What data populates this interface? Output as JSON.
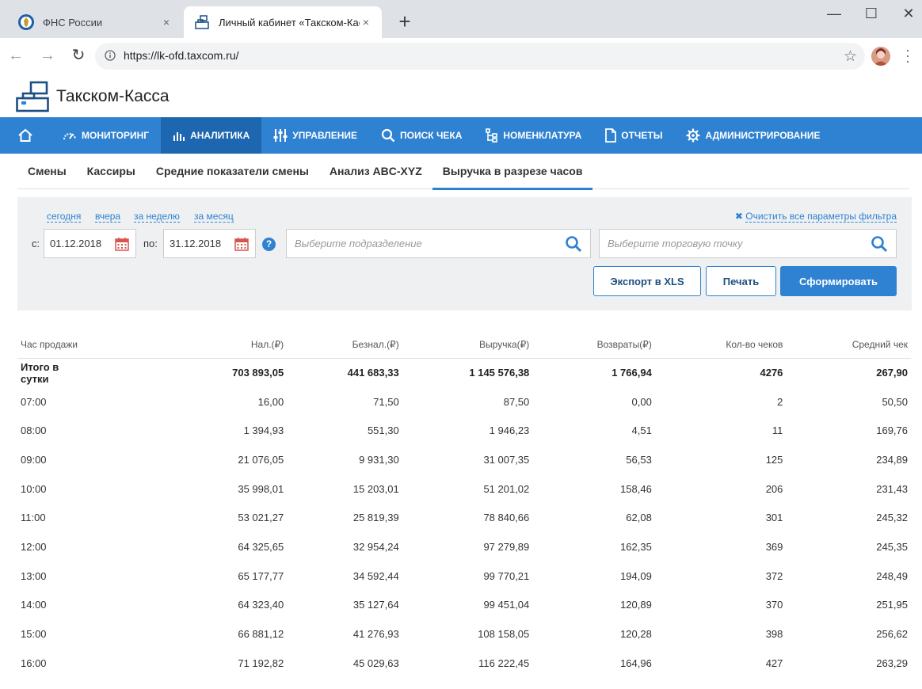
{
  "browser": {
    "tabs": [
      {
        "title": "ФНС России",
        "active": false
      },
      {
        "title": "Личный кабинет «Такском-Касса»",
        "active": true
      }
    ],
    "url": "https://lk-ofd.taxcom.ru/",
    "new_tab": "+",
    "close": "×",
    "minimize": "—",
    "maximize": "☐",
    "window_close": "✕"
  },
  "app": {
    "brand": "Такском-Касса"
  },
  "nav": {
    "items": [
      {
        "label": "Мониторинг",
        "icon": "gauge-icon"
      },
      {
        "label": "Аналитика",
        "icon": "bar-chart-icon",
        "active": true
      },
      {
        "label": "Управление",
        "icon": "sliders-icon"
      },
      {
        "label": "Поиск чека",
        "icon": "search-icon"
      },
      {
        "label": "Номенклатура",
        "icon": "hierarchy-icon"
      },
      {
        "label": "Отчеты",
        "icon": "document-icon"
      },
      {
        "label": "Администрирование",
        "icon": "gear-icon"
      }
    ]
  },
  "subtabs": [
    {
      "label": "Смены"
    },
    {
      "label": "Кассиры"
    },
    {
      "label": "Средние показатели смены"
    },
    {
      "label": "Анализ ABC-XYZ"
    },
    {
      "label": "Выручка в разрезе часов",
      "active": true
    }
  ],
  "filter": {
    "quick": [
      "сегодня",
      "вчера",
      "за неделю",
      "за месяц"
    ],
    "clear": "Очистить все параметры фильтра",
    "from_label": "с:",
    "to_label": "по:",
    "date_from": "01.12.2018",
    "date_to": "31.12.2018",
    "help": "?",
    "division_placeholder": "Выберите подразделение",
    "point_placeholder": "Выберите торговую точку",
    "export": "Экспорт в XLS",
    "print": "Печать",
    "generate": "Сформировать"
  },
  "table": {
    "columns": [
      "Час продажи",
      "Нал.(₽)",
      "Безнал.(₽)",
      "Выручка(₽)",
      "Возвраты(₽)",
      "Кол-во чеков",
      "Средний чек"
    ],
    "total": [
      "Итого в сутки",
      "703 893,05",
      "441 683,33",
      "1 145 576,38",
      "1 766,94",
      "4276",
      "267,90"
    ],
    "rows": [
      [
        "07:00",
        "16,00",
        "71,50",
        "87,50",
        "0,00",
        "2",
        "50,50"
      ],
      [
        "08:00",
        "1 394,93",
        "551,30",
        "1 946,23",
        "4,51",
        "11",
        "169,76"
      ],
      [
        "09:00",
        "21 076,05",
        "9 931,30",
        "31 007,35",
        "56,53",
        "125",
        "234,89"
      ],
      [
        "10:00",
        "35 998,01",
        "15 203,01",
        "51 201,02",
        "158,46",
        "206",
        "231,43"
      ],
      [
        "11:00",
        "53 021,27",
        "25 819,39",
        "78 840,66",
        "62,08",
        "301",
        "245,32"
      ],
      [
        "12:00",
        "64 325,65",
        "32 954,24",
        "97 279,89",
        "162,35",
        "369",
        "245,35"
      ],
      [
        "13:00",
        "65 177,77",
        "34 592,44",
        "99 770,21",
        "194,09",
        "372",
        "248,49"
      ],
      [
        "14:00",
        "64 323,40",
        "35 127,64",
        "99 451,04",
        "120,89",
        "370",
        "251,95"
      ],
      [
        "15:00",
        "66 881,12",
        "41 276,93",
        "108 158,05",
        "120,28",
        "398",
        "256,62"
      ],
      [
        "16:00",
        "71 192,82",
        "45 029,63",
        "116 222,45",
        "164,96",
        "427",
        "263,29"
      ]
    ]
  },
  "colors": {
    "accent": "#2f82d1",
    "nav_active": "#1d67b0"
  }
}
